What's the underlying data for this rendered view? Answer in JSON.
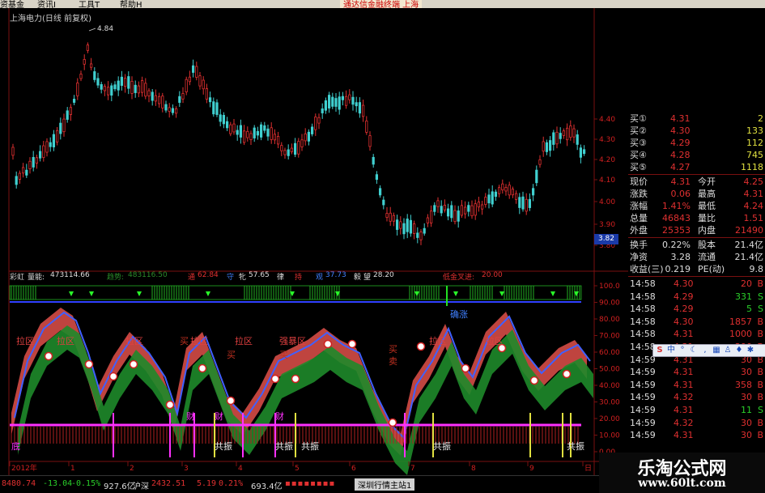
{
  "menu": {
    "items": [
      "资基金",
      "资讯I",
      "工具T",
      "帮助H"
    ],
    "promo": "通达信金融终端 上海"
  },
  "chart": {
    "title": "上海电力(日线 前复权)",
    "high_label": "4.84",
    "price_box": "3.82",
    "price_axis": [
      "4.40",
      "4.30",
      "4.20",
      "4.10",
      "4.00",
      "3.90",
      "3.80"
    ],
    "indicator_axis": [
      "100.0",
      "90.00",
      "80.00",
      "70.00",
      "60.00",
      "50.00",
      "40.00",
      "30.00",
      "20.00",
      "10.00",
      "0.00"
    ]
  },
  "indicator": {
    "name": "彩虹",
    "volume_label": "量能:",
    "volume_value": "473114.66",
    "trend_label": "趋势:",
    "trend_value": "483116.50",
    "items": [
      {
        "label": "通",
        "value": "62.84"
      },
      {
        "label": "守",
        "value": ""
      },
      {
        "label": "牝",
        "value": "57.65"
      },
      {
        "label": "律",
        "value": ""
      },
      {
        "label": "持",
        "value": ""
      },
      {
        "label": "观",
        "value": "37.73"
      },
      {
        "label": "毅",
        "value": ""
      },
      {
        "label": "望",
        "value": "28.20"
      }
    ],
    "cross_label": "低金叉进:",
    "cross_value": "20.00",
    "zone_labels": [
      "拉区",
      "拉区",
      "拉区",
      "拉区",
      "拉区",
      "强暴区",
      "拉区",
      "拉区"
    ],
    "buy_labels": [
      "买",
      "买",
      "买",
      "买"
    ],
    "sell_label": "卖",
    "resonance_labels": [
      "共振",
      "共振",
      "共振",
      "共振",
      "共振"
    ],
    "fortune_labels": [
      "财",
      "财",
      "财"
    ],
    "confirm_label": "确涨",
    "bottom_label": "底"
  },
  "quote": {
    "bids": [
      {
        "label": "买①",
        "price": "4.31",
        "vol": "2"
      },
      {
        "label": "买②",
        "price": "4.30",
        "vol": "133"
      },
      {
        "label": "买③",
        "price": "4.29",
        "vol": "112"
      },
      {
        "label": "买④",
        "price": "4.28",
        "vol": "745"
      },
      {
        "label": "买⑤",
        "price": "4.27",
        "vol": "1118"
      }
    ],
    "stats": [
      {
        "l1": "现价",
        "v1": "4.31",
        "l2": "今开",
        "v2": "4.25"
      },
      {
        "l1": "涨跌",
        "v1": "0.06",
        "l2": "最高",
        "v2": "4.31"
      },
      {
        "l1": "涨幅",
        "v1": "1.41%",
        "l2": "最低",
        "v2": "4.24"
      },
      {
        "l1": "总量",
        "v1": "46843",
        "l2": "量比",
        "v2": "1.51"
      },
      {
        "l1": "外盘",
        "v1": "25353",
        "l2": "内盘",
        "v2": "21490"
      }
    ],
    "finance": [
      {
        "l1": "换手",
        "v1": "0.22%",
        "l2": "股本",
        "v2": "21.4亿"
      },
      {
        "l1": "净资",
        "v1": "3.28",
        "l2": "流通",
        "v2": "21.4亿"
      },
      {
        "l1": "收益(三)",
        "v1": "0.219",
        "l2": "PE(动)",
        "v2": "9.8"
      }
    ],
    "ticks": [
      {
        "time": "14:58",
        "price": "4.30",
        "vol": "20",
        "flag": "B"
      },
      {
        "time": "14:58",
        "price": "4.29",
        "vol": "331",
        "flag": "S"
      },
      {
        "time": "14:58",
        "price": "4.29",
        "vol": "5",
        "flag": "S"
      },
      {
        "time": "14:58",
        "price": "4.30",
        "vol": "1857",
        "flag": "B"
      },
      {
        "time": "14:58",
        "price": "4.31",
        "vol": "1000",
        "flag": "B"
      },
      {
        "time": "14:58",
        "price": "4.31",
        "vol": "290",
        "flag": "B"
      },
      {
        "time": "14:59",
        "price": "4.31",
        "vol": "30",
        "flag": "B"
      },
      {
        "time": "14:59",
        "price": "4.31",
        "vol": "30",
        "flag": "B"
      },
      {
        "time": "14:59",
        "price": "4.31",
        "vol": "358",
        "flag": "B"
      },
      {
        "time": "14:59",
        "price": "4.32",
        "vol": "30",
        "flag": "B"
      },
      {
        "time": "14:59",
        "price": "4.31",
        "vol": "11",
        "flag": "S"
      },
      {
        "time": "14:59",
        "price": "4.32",
        "vol": "30",
        "flag": "B"
      },
      {
        "time": "14:59",
        "price": "4.31",
        "vol": "30",
        "flag": "B"
      }
    ]
  },
  "time_axis": [
    "2012年",
    "1",
    "2",
    "3",
    "4",
    "5",
    "6",
    "7",
    "8",
    "9",
    "日"
  ],
  "status_bar": {
    "sh_index": "8480.74",
    "sh_change": "-13.04",
    "sh_pct": "-0.15%",
    "sh_amount": "927.6亿",
    "sz_label": "沪深",
    "sz_index": "2432.51",
    "sz_change": "5.19",
    "sz_pct": "0.21%",
    "sz_amount": "693.4亿",
    "station": "深圳行情主站1"
  },
  "brand": {
    "name": "乐淘公式网",
    "url": "www.60lt.com"
  },
  "colors": {
    "up": "#e03030",
    "down": "#40d0d0",
    "axis_red": "#d02020",
    "magenta": "#ff30ff",
    "green_fill": "#1e8a2a",
    "red_fill": "#e0504a"
  }
}
